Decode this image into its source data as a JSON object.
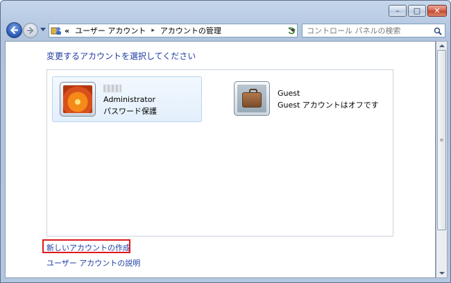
{
  "window": {
    "controls": {
      "minimize": "–",
      "maximize": "□",
      "close": "✕"
    }
  },
  "nav": {
    "breadcrumb": {
      "prefix": "«",
      "item1": "ユーザー アカウント",
      "separator": "▸",
      "item2": "アカウントの管理"
    },
    "search_placeholder": "コントロール パネルの検索",
    "icons": {
      "back": "back-arrow-icon",
      "forward": "forward-arrow-icon",
      "refresh": "refresh-icon",
      "search": "search-icon",
      "location": "user-accounts-icon"
    }
  },
  "main": {
    "heading": "変更するアカウントを選択してください",
    "accounts": [
      {
        "name": "Administrator",
        "detail": "パスワード保護",
        "picture": "flower-picture",
        "selected": true
      },
      {
        "name": "Guest",
        "detail": "Guest アカウントはオフです",
        "picture": "suitcase-picture",
        "selected": false
      }
    ],
    "links": [
      {
        "label": "新しいアカウントの作成",
        "highlighted": true
      },
      {
        "label": "ユーザー アカウントの説明",
        "highlighted": false
      }
    ]
  },
  "colors": {
    "link": "#1d3aa3",
    "highlight_border": "#e0181c",
    "selection_border": "#b5d4f1"
  }
}
